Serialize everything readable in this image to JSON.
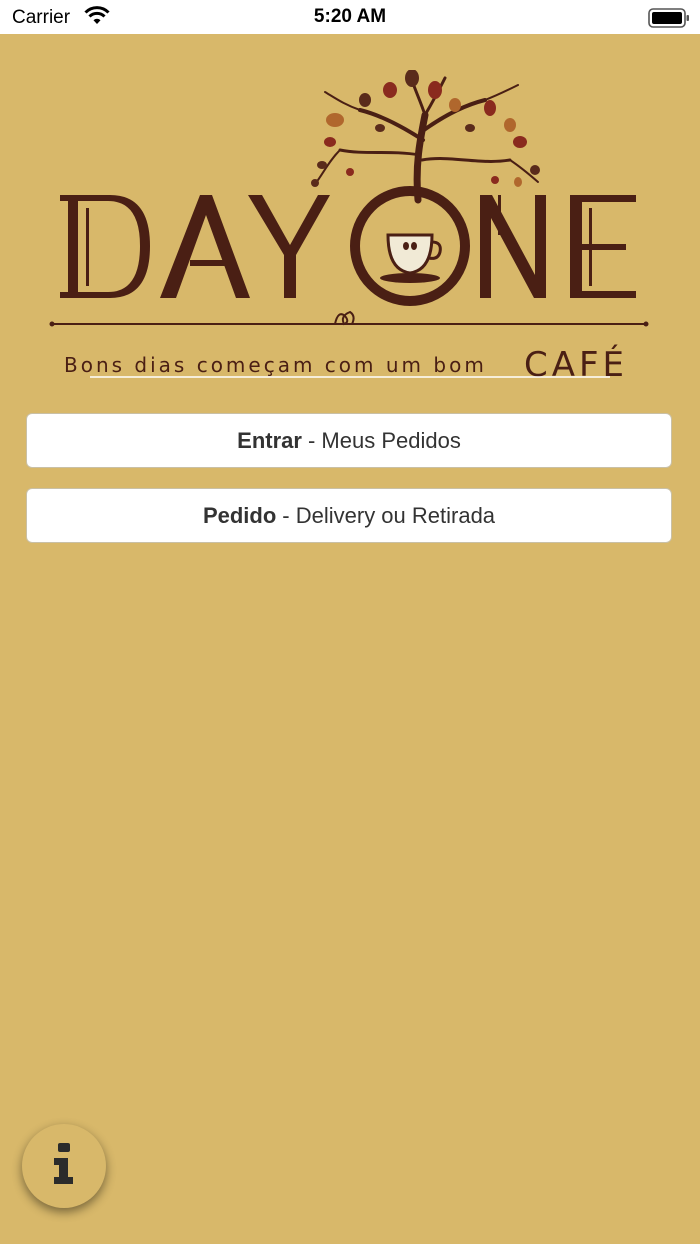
{
  "status_bar": {
    "carrier": "Carrier",
    "time": "5:20 AM",
    "wifi_icon": "wifi-icon",
    "battery_icon": "battery-icon"
  },
  "logo": {
    "title": "DAY ONE",
    "tagline_prefix": "Bons dias  começam com um bom",
    "tagline_emphasis": "CAFÉ"
  },
  "buttons": [
    {
      "bold": "Entrar",
      "text": "- Meus Pedidos"
    },
    {
      "bold": "Pedido",
      "text": "- Delivery ou Retirada"
    }
  ],
  "fab": {
    "icon": "info-icon"
  },
  "colors": {
    "background": "#d8b86a",
    "brand_brown": "#4a1f14",
    "button_bg": "#ffffff"
  }
}
